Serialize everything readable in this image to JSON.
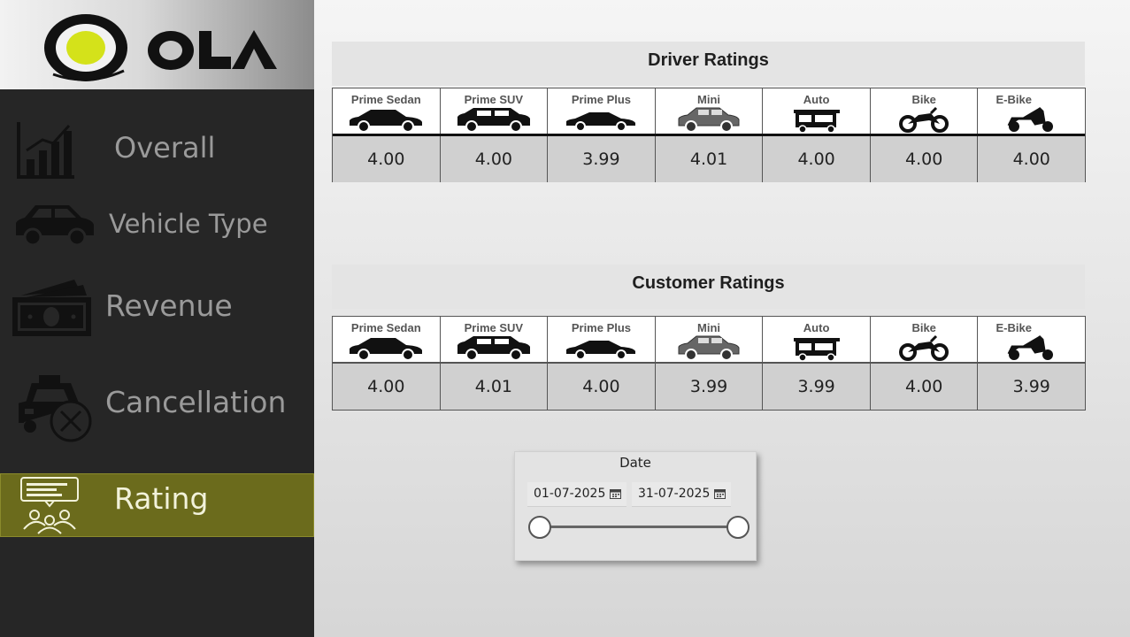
{
  "brand": {
    "name": "OLA",
    "logo_accent": "#d4e21a"
  },
  "colors": {
    "sidebar_bg": "#262626",
    "active_bg": "#6b6b1c",
    "nav_text": "#9a9a9a"
  },
  "nav": {
    "items": [
      {
        "label": "Overall",
        "icon": "bar-chart-icon"
      },
      {
        "label": "Vehicle Type",
        "icon": "car-icon"
      },
      {
        "label": "Revenue",
        "icon": "cash-icon"
      },
      {
        "label": "Cancellation",
        "icon": "taxi-cancel-icon"
      },
      {
        "label": "Rating",
        "icon": "feedback-people-icon",
        "active": true
      }
    ]
  },
  "driver_ratings": {
    "title": "Driver Ratings",
    "categories": [
      "Prime Sedan",
      "Prime SUV",
      "Prime Plus",
      "Mini",
      "Auto",
      "Bike",
      "E-Bike"
    ],
    "values": [
      "4.00",
      "4.00",
      "3.99",
      "4.01",
      "4.00",
      "4.00",
      "4.00"
    ]
  },
  "customer_ratings": {
    "title": "Customer Ratings",
    "categories": [
      "Prime Sedan",
      "Prime SUV",
      "Prime Plus",
      "Mini",
      "Auto",
      "Bike",
      "E-Bike"
    ],
    "values": [
      "4.00",
      "4.01",
      "4.00",
      "3.99",
      "3.99",
      "4.00",
      "3.99"
    ]
  },
  "date_slicer": {
    "title": "Date",
    "start": "01-07-2025",
    "end": "31-07-2025"
  }
}
